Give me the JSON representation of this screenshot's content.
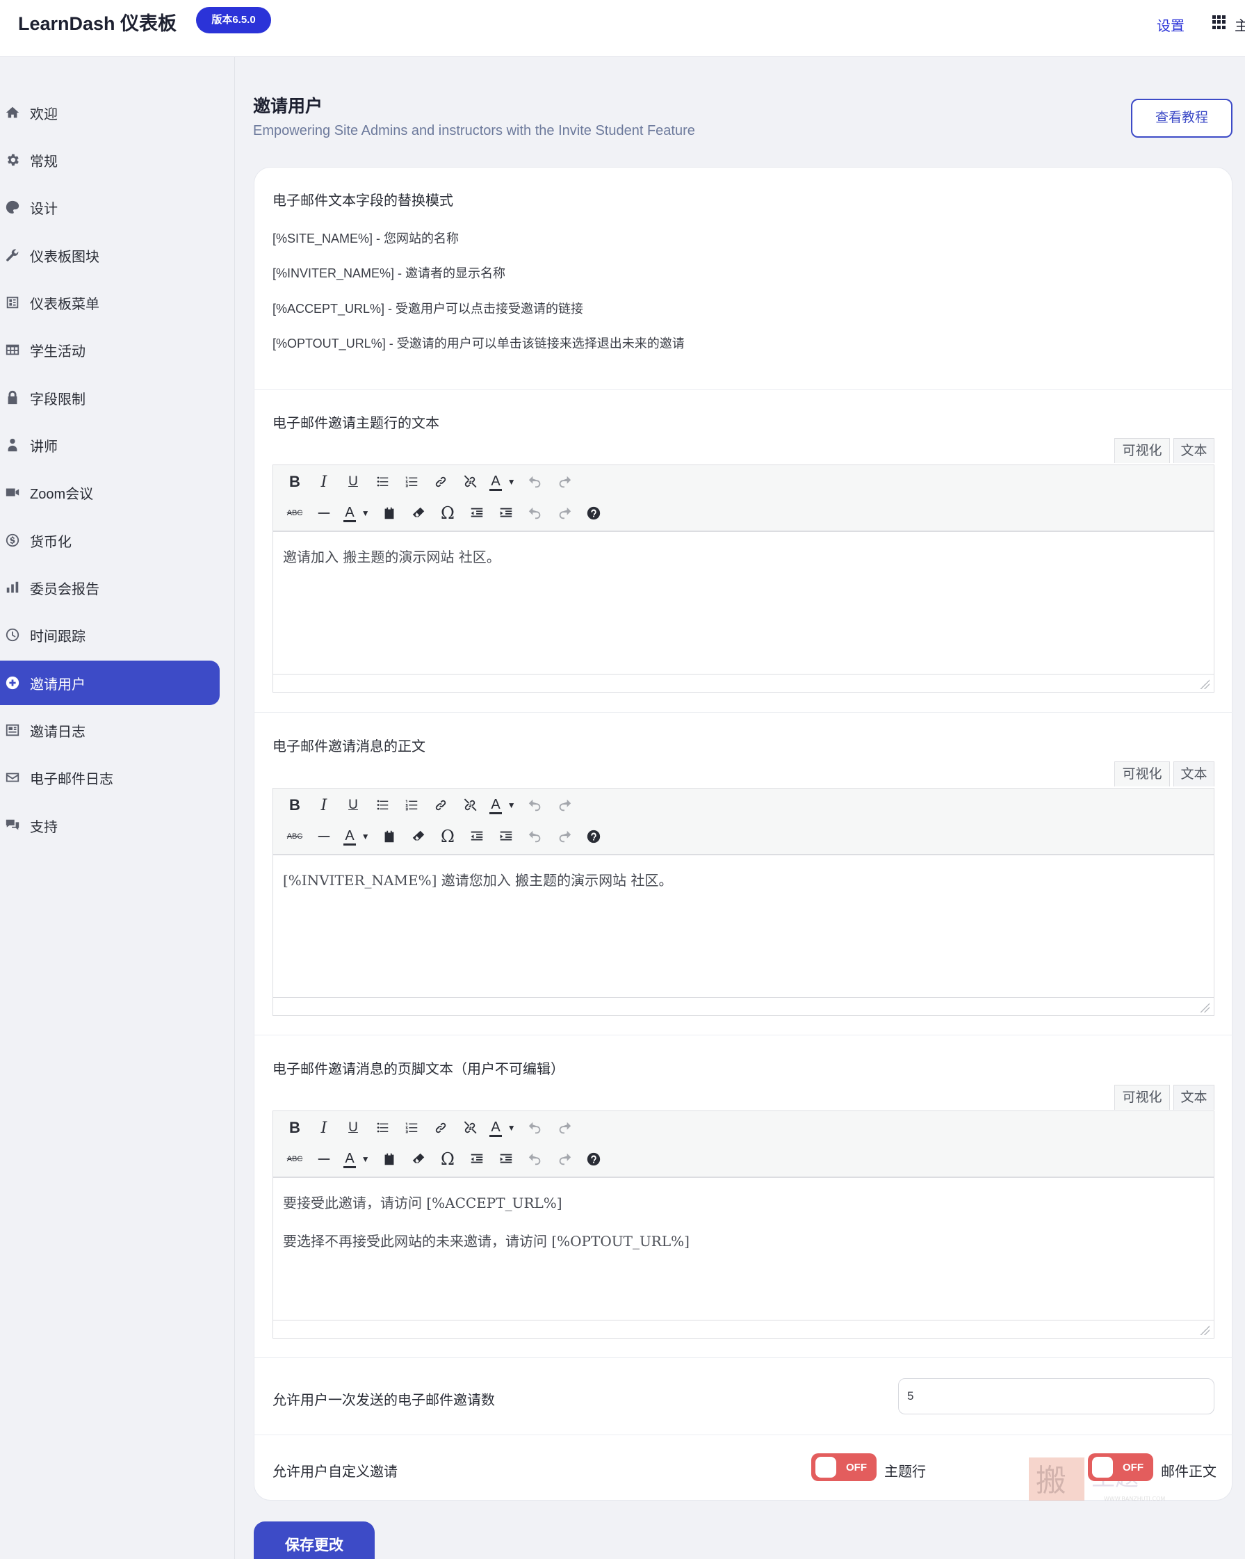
{
  "header": {
    "brand": "LearnDash 仪表板",
    "version": "版本6.5.0",
    "settings_link": "设置",
    "more_link": "主"
  },
  "sidebar": {
    "items": [
      {
        "label": "欢迎",
        "icon": "home-icon"
      },
      {
        "label": "常规",
        "icon": "gear-icon"
      },
      {
        "label": "设计",
        "icon": "palette-icon"
      },
      {
        "label": "仪表板图块",
        "icon": "wrench-icon"
      },
      {
        "label": "仪表板菜单",
        "icon": "menu-board-icon"
      },
      {
        "label": "学生活动",
        "icon": "calendar-grid-icon"
      },
      {
        "label": "字段限制",
        "icon": "lock-icon"
      },
      {
        "label": "讲师",
        "icon": "instructor-icon"
      },
      {
        "label": "Zoom会议",
        "icon": "video-camera-icon"
      },
      {
        "label": "货币化",
        "icon": "dollar-circle-icon"
      },
      {
        "label": "委员会报告",
        "icon": "bar-chart-icon"
      },
      {
        "label": "时间跟踪",
        "icon": "clock-icon"
      },
      {
        "label": "邀请用户",
        "icon": "plus-circle-icon",
        "active": true
      },
      {
        "label": "邀请日志",
        "icon": "log-icon"
      },
      {
        "label": "电子邮件日志",
        "icon": "envelope-icon"
      },
      {
        "label": "支持",
        "icon": "chat-bubbles-icon"
      }
    ]
  },
  "page": {
    "title": "邀请用户",
    "subtitle": "Empowering Site Admins and instructors with the Invite Student Feature",
    "tutorial_button": "查看教程"
  },
  "tokens": {
    "heading": "电子邮件文本字段的替换模式",
    "lines": [
      "[%SITE_NAME%] - 您网站的名称",
      "[%INVITER_NAME%] - 邀请者的显示名称",
      "[%ACCEPT_URL%] - 受邀用户可以点击接受邀请的链接",
      "[%OPTOUT_URL%] - 受邀请的用户可以单击该链接来选择退出未来的邀请"
    ]
  },
  "editor_tabs": {
    "visual": "可视化",
    "text": "文本"
  },
  "editors": [
    {
      "label": "电子邮件邀请主题行的文本",
      "paragraphs": [
        "邀请加入 搬主题的演示网站 社区。"
      ]
    },
    {
      "label": "电子邮件邀请消息的正文",
      "paragraphs": [
        "[%INVITER_NAME%] 邀请您加入 搬主题的演示网站 社区。"
      ]
    },
    {
      "label": "电子邮件邀请消息的页脚文本（用户不可编辑）",
      "paragraphs": [
        "要接受此邀请，请访问 [%ACCEPT_URL%]",
        "要选择不再接受此网站的未来邀请，请访问 [%OPTOUT_URL%]"
      ]
    }
  ],
  "toolbar": {
    "bold": "B",
    "italic": "I",
    "underline": "U",
    "color_letter": "A",
    "strikethrough": "ABC",
    "omega": "Ω",
    "help": "?"
  },
  "settings": {
    "max_invites_label": "允许用户一次发送的电子邮件邀请数",
    "max_invites_value": "5",
    "customize_label": "允许用户自定义邀请",
    "toggles": [
      {
        "state": "OFF",
        "label": "主题行",
        "on": false
      },
      {
        "state": "OFF",
        "label": "邮件正文",
        "on": false
      }
    ]
  },
  "watermark": {
    "text": "搬主题",
    "url": "WWW.BANZHUTI.COM"
  },
  "save_button": "保存更改",
  "colors": {
    "accent": "#3d4bc7",
    "badge": "#2b33d8",
    "toggle_off": "#e35d5d"
  }
}
